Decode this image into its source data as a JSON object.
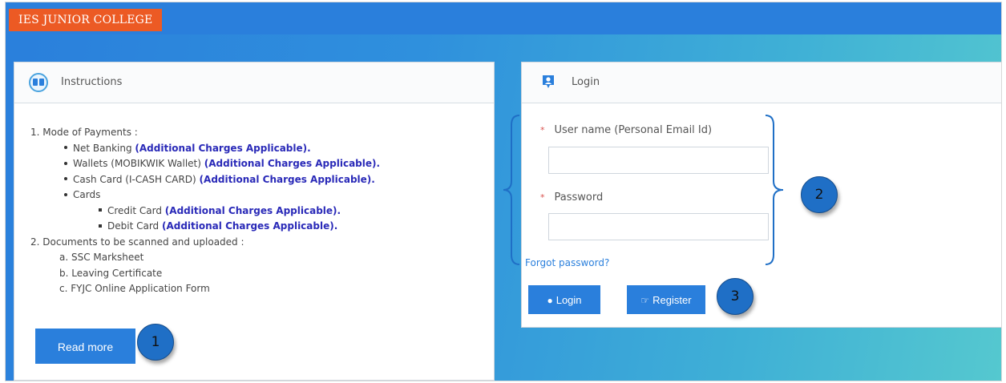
{
  "header": {
    "brand": "IES JUNIOR COLLEGE"
  },
  "instructions": {
    "title": "Instructions",
    "icon": "book-icon",
    "lines": [
      {
        "text": "1. Mode of Payments :",
        "bold": ""
      },
      {
        "text": "Net Banking ",
        "bold": "(Additional Charges Applicable)."
      },
      {
        "text": "Wallets (MOBIKWIK Wallet) ",
        "bold": "(Additional Charges Applicable)."
      },
      {
        "text": "Cash Card (I-CASH CARD) ",
        "bold": "(Additional Charges Applicable)."
      },
      {
        "text": "Cards",
        "bold": ""
      },
      {
        "text": "Credit Card ",
        "bold": "(Additional Charges Applicable)."
      },
      {
        "text": "Debit Card ",
        "bold": "(Additional Charges Applicable)."
      },
      {
        "text": "2. Documents to be scanned and uploaded :",
        "bold": ""
      },
      {
        "text": "a. SSC Marksheet",
        "bold": ""
      },
      {
        "text": "b. Leaving Certificate",
        "bold": ""
      },
      {
        "text": "c. FYJC Online Application Form",
        "bold": ""
      }
    ],
    "read_more": "Read more"
  },
  "login": {
    "title": "Login",
    "icon": "location-pin-icon",
    "username_label": "User name (Personal Email Id)",
    "password_label": "Password",
    "required_mark": "*",
    "username_value": "",
    "password_value": "",
    "forgot": "Forgot password?",
    "login_button": "Login",
    "register_button": "Register"
  },
  "annotations": {
    "one": "1",
    "two": "2",
    "three": "3"
  },
  "colors": {
    "accent": "#2a7fdc",
    "brand": "#ec5a24",
    "link_bold": "#2a2ab8",
    "required": "#d9534f"
  }
}
